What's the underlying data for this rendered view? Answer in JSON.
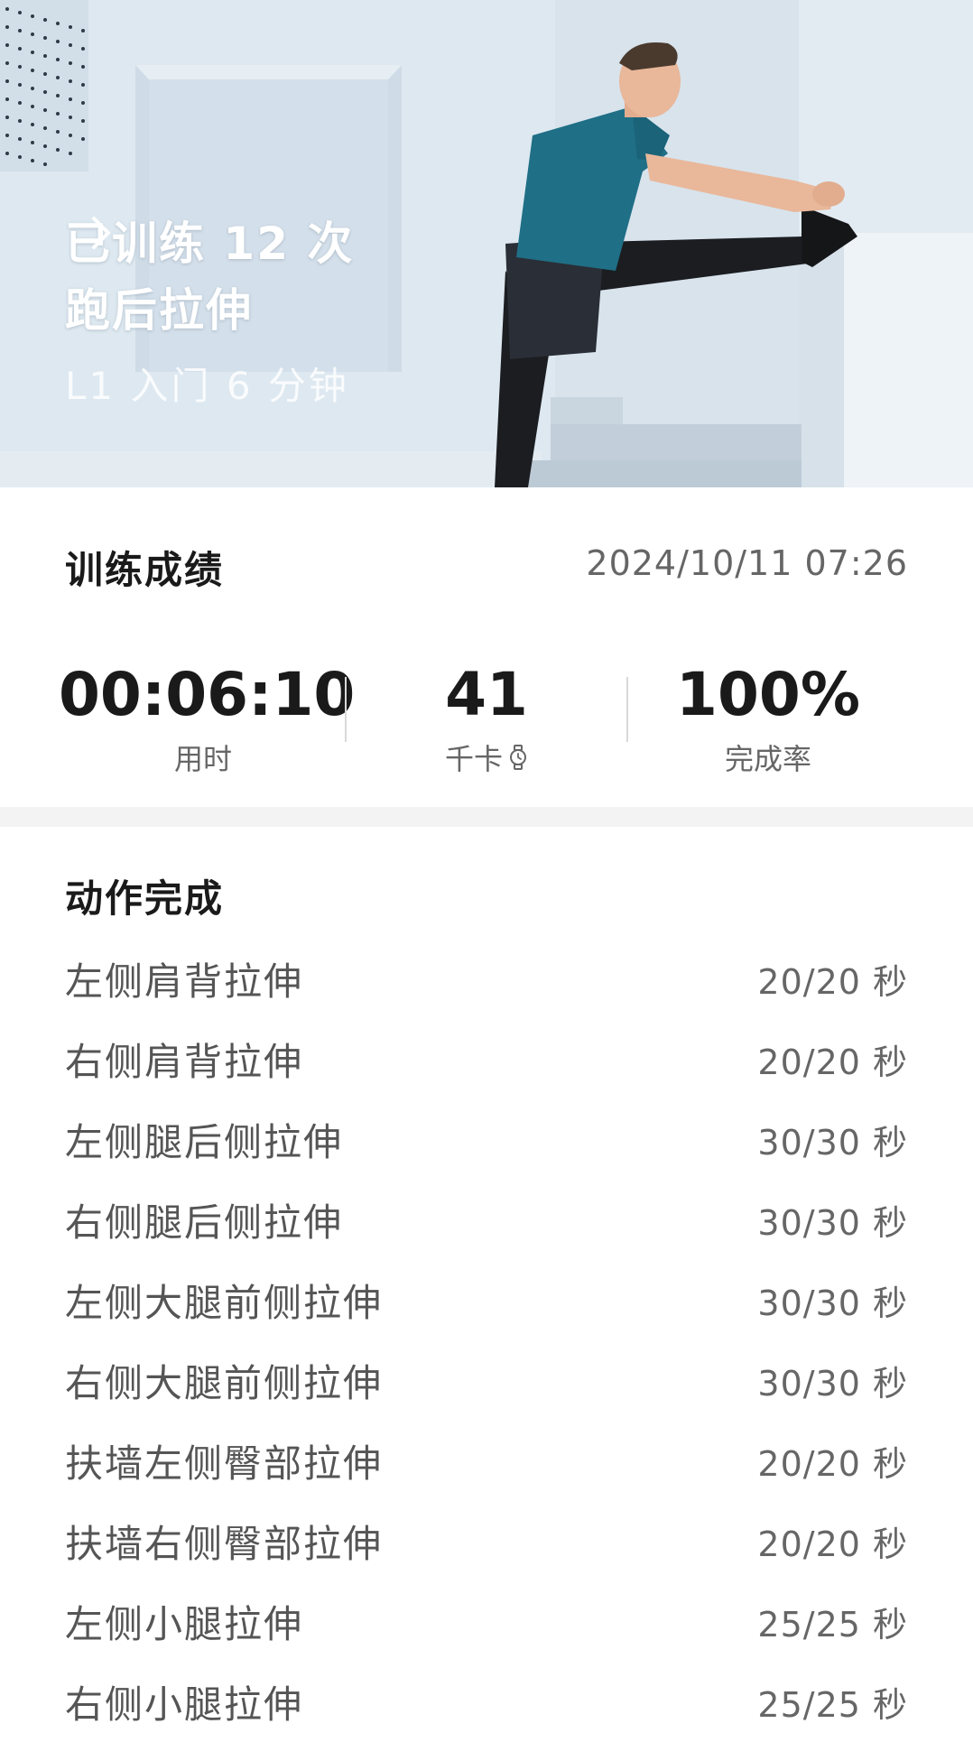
{
  "hero": {
    "count_text": "已训练 12 次",
    "title": "跑后拉伸",
    "level_text": "L1 入门 6 分钟"
  },
  "results": {
    "title": "训练成绩",
    "datetime": "2024/10/11 07:26",
    "stats": [
      {
        "value": "00:06:10",
        "label": "用时"
      },
      {
        "value": "41",
        "label": "千卡",
        "icon": "watch-icon"
      },
      {
        "value": "100%",
        "label": "完成率"
      }
    ]
  },
  "actions": {
    "title": "动作完成",
    "items": [
      {
        "name": "左侧肩背拉伸",
        "progress": "20/20 秒"
      },
      {
        "name": "右侧肩背拉伸",
        "progress": "20/20 秒"
      },
      {
        "name": "左侧腿后侧拉伸",
        "progress": "30/30 秒"
      },
      {
        "name": "右侧腿后侧拉伸",
        "progress": "30/30 秒"
      },
      {
        "name": "左侧大腿前侧拉伸",
        "progress": "30/30 秒"
      },
      {
        "name": "右侧大腿前侧拉伸",
        "progress": "30/30 秒"
      },
      {
        "name": "扶墙左侧臀部拉伸",
        "progress": "20/20 秒"
      },
      {
        "name": "扶墙右侧臀部拉伸",
        "progress": "20/20 秒"
      },
      {
        "name": "左侧小腿拉伸",
        "progress": "25/25 秒"
      },
      {
        "name": "右侧小腿拉伸",
        "progress": "25/25 秒"
      }
    ]
  },
  "colors": {
    "text_primary": "#1a1a1a",
    "text_secondary": "#666666",
    "shirt": "#1f6f86",
    "background_wall": "#dfe9f1"
  }
}
